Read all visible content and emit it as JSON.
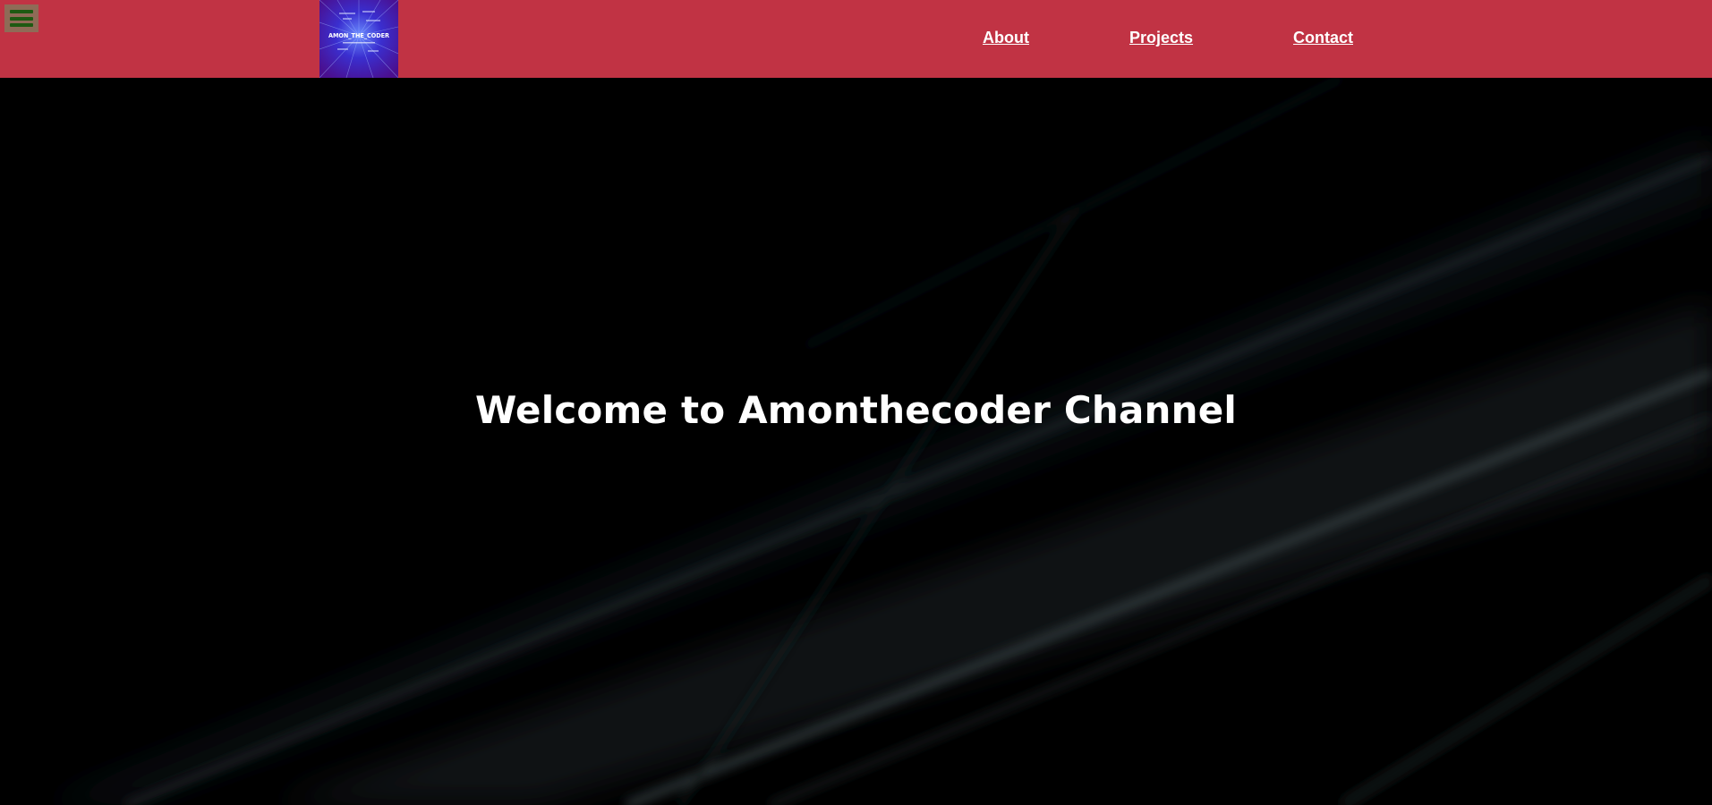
{
  "header": {
    "menu_icon": "hamburger-icon",
    "logo": {
      "icon": "channel-logo",
      "text": "AMON_THE_CODER"
    },
    "nav": [
      {
        "label": "About"
      },
      {
        "label": "Projects"
      },
      {
        "label": "Contact"
      }
    ]
  },
  "hero": {
    "title": "Welcome to Amonthecoder Channel"
  },
  "colors": {
    "header_bg": "#c13344",
    "menu_button_bg": "#8f6b57",
    "menu_bars": "#1e5a12",
    "hero_bg": "#000000",
    "text": "#ffffff"
  }
}
